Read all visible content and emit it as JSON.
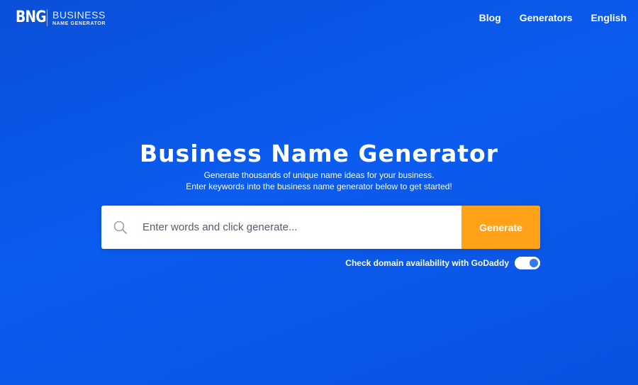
{
  "header": {
    "logo_mark": "BNG",
    "logo_text_top": "BUSINESS",
    "logo_text_bottom": "NAME GENERATOR",
    "nav": [
      {
        "label": "Blog"
      },
      {
        "label": "Generators"
      },
      {
        "label": "English"
      }
    ]
  },
  "hero": {
    "title": "Business Name Generator",
    "subtitle_line1": "Generate thousands of unique name ideas for your business.",
    "subtitle_line2": "Enter keywords into the business name generator below to get started!"
  },
  "search": {
    "icon": "search-icon",
    "placeholder": "Enter words and click generate...",
    "value": "",
    "button_label": "Generate"
  },
  "domain_check": {
    "label": "Check domain availability with GoDaddy",
    "enabled": true
  },
  "colors": {
    "background": "#0b5cf0",
    "accent_button": "#ffa21a",
    "toggle_knob": "#2f7bf0"
  }
}
